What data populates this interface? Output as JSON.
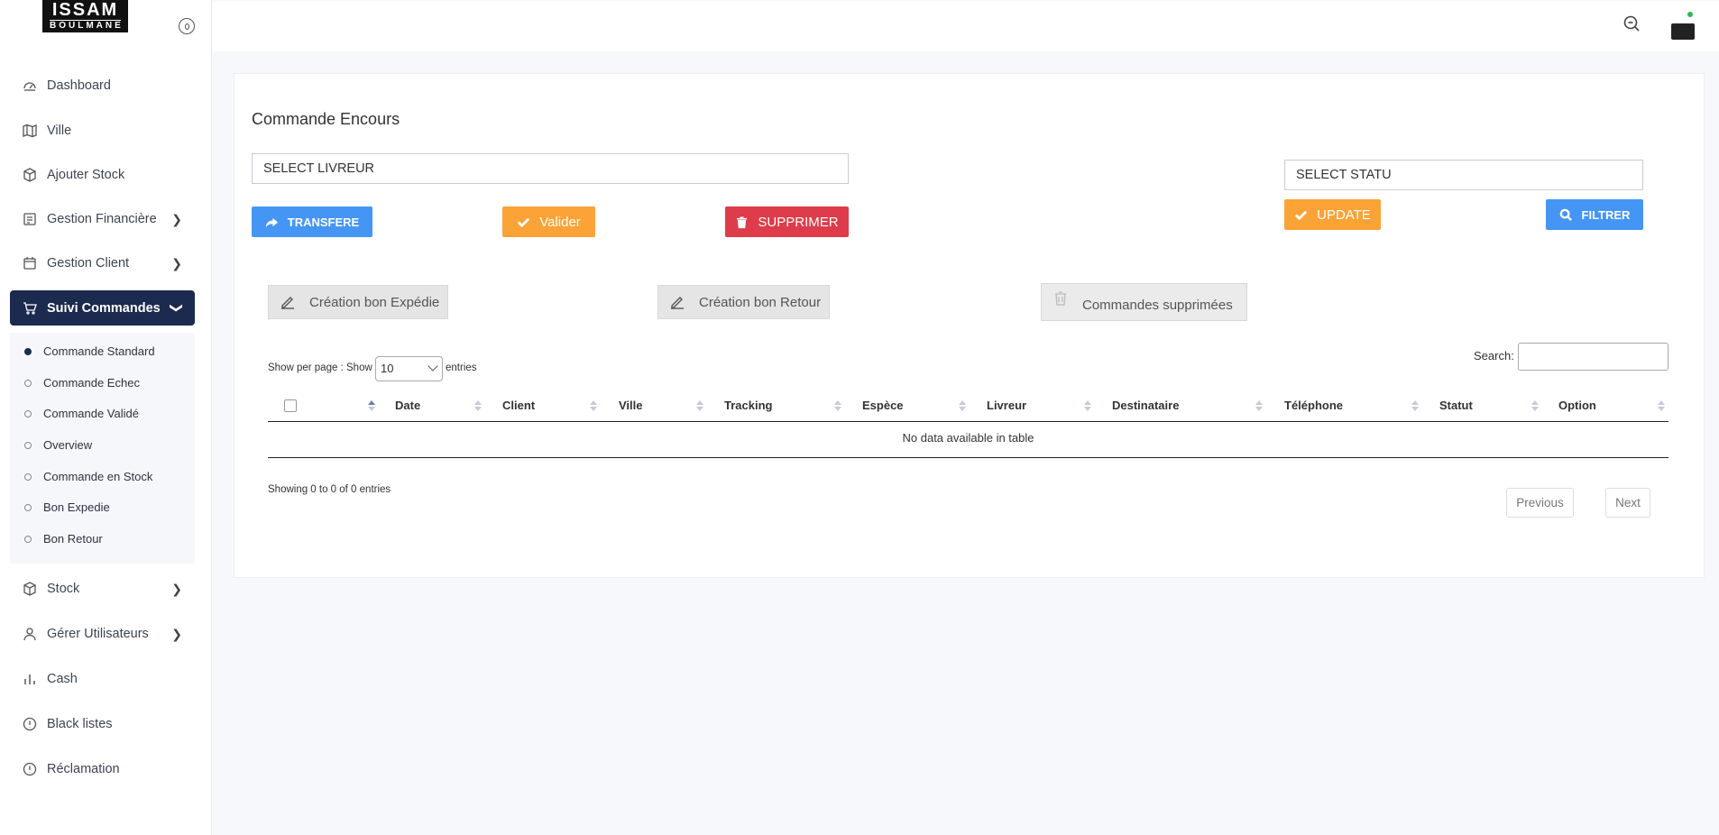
{
  "logo": {
    "line1": "ISSAM",
    "line2": "BOULMANE"
  },
  "sidebar": {
    "items": [
      {
        "label": "Dashboard",
        "icon": "dashboard-icon"
      },
      {
        "label": "Ville",
        "icon": "map-icon"
      },
      {
        "label": "Ajouter Stock",
        "icon": "box-icon"
      },
      {
        "label": "Gestion Financière",
        "icon": "receipt-icon"
      },
      {
        "label": "Gestion Client",
        "icon": "calendar-icon"
      },
      {
        "label": "Suivi Commandes",
        "icon": "cart-icon"
      },
      {
        "label": "Stock",
        "icon": "box-icon"
      },
      {
        "label": "Gérer Utilisateurs",
        "icon": "user-icon"
      },
      {
        "label": "Cash",
        "icon": "bar-chart-icon"
      },
      {
        "label": "Black listes",
        "icon": "alert-circle-icon"
      },
      {
        "label": "Réclamation",
        "icon": "alert-circle-icon"
      }
    ],
    "submenu": [
      "Commande Standard",
      "Commande Echec",
      "Commande Validé",
      "Overview",
      "Commande en Stock",
      "Bon Expedie",
      "Bon Retour"
    ]
  },
  "main": {
    "title": "Commande Encours",
    "select_livreur": "SELECT LIVREUR",
    "select_statu": "SELECT STATU",
    "buttons": {
      "transfere": "TRANSFERE",
      "valider": "Valider",
      "supprimer": "SUPPRIMER",
      "update": "UPDATE",
      "filtrer": "FILTRER",
      "bon_expedie": "Création bon Expédie",
      "bon_retour": "Création bon Retour",
      "supprimees": "Commandes supprimées"
    },
    "table": {
      "show_per_page": "Show per page :",
      "show": "Show",
      "entries_value": "10",
      "entries": "entries",
      "search_label": "Search:",
      "columns": [
        "Date",
        "Client",
        "Ville",
        "Tracking",
        "Espèce",
        "Livreur",
        "Destinataire",
        "Téléphone",
        "Statut",
        "Option"
      ],
      "empty": "No data available in table",
      "showing": "Showing 0 to 0 of 0 entries",
      "previous": "Previous",
      "next": "Next"
    }
  },
  "colors": {
    "sidebar_active": "#1c2a50",
    "blue": "#4596f4",
    "orange": "#fba336",
    "red": "#de3c4a"
  }
}
